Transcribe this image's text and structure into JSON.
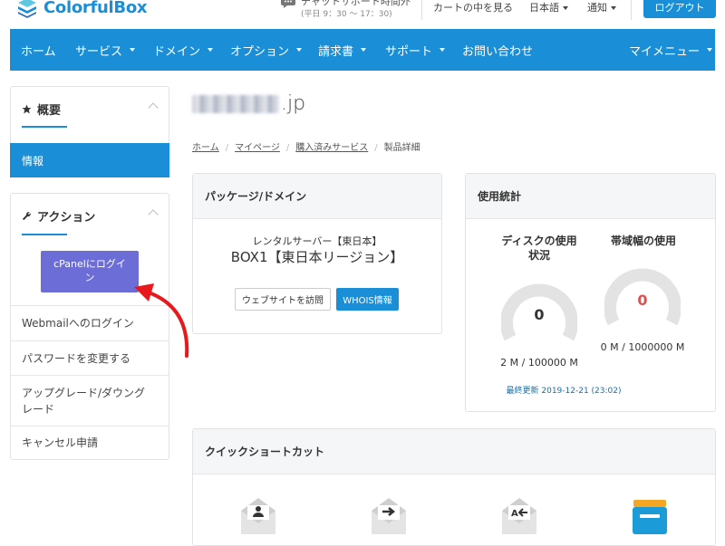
{
  "brand": {
    "name": "ColorfulBox",
    "accent": "#1a8fd8"
  },
  "topbar": {
    "support_title": "チャットサポート時間外",
    "support_hours": "(平日 9：30 ～ 17：30)",
    "cart_link": "カートの中を見る",
    "language": "日本語",
    "notifications": "通知",
    "logout": "ログアウト"
  },
  "nav": {
    "items": [
      "ホーム",
      "サービス",
      "ドメイン",
      "オプション",
      "請求書",
      "サポート",
      "お問い合わせ"
    ],
    "my_menu": "マイメニュー"
  },
  "sidebar": {
    "overview_title": "概要",
    "overview_active": "情報",
    "actions_title": "アクション",
    "cpanel_button": "cPanelにログイン",
    "cpanel_button_l1": "cPanelにログイ",
    "cpanel_button_l2": "ン",
    "links": [
      "Webmailへのログイン",
      "パスワードを変更する",
      "アップグレード/ダウングレード",
      "キャンセル申請"
    ],
    "upgrade_l1": "アップグレード/ダウング",
    "upgrade_l2": "レード"
  },
  "page": {
    "domain_suffix": ".jp",
    "breadcrumb": [
      "ホーム",
      "マイページ",
      "購入済みサービス",
      "製品詳細"
    ]
  },
  "package": {
    "title": "パッケージ/ドメイン",
    "server_type": "レンタルサーバー【東日本】",
    "plan": "BOX1【東日本リージョン】",
    "visit_button": "ウェブサイトを訪問",
    "whois_button": "WHOIS情報"
  },
  "usage": {
    "title": "使用統計",
    "disk_label_l1": "ディスクの使用",
    "disk_label_l2": "状況",
    "disk_value": "0",
    "disk_caption": "2 M / 100000 M",
    "disk_fraction": 0.0,
    "bandwidth_label": "帯域幅の使用",
    "bandwidth_value": "0",
    "bandwidth_caption": "0 M / 1000000 M",
    "bandwidth_fraction": 0.0,
    "last_updated": "最終更新 2019-12-21 (23:02)",
    "disk_color": "#333333",
    "bandwidth_color": "#d9534f"
  },
  "shortcuts": {
    "title": "クイックショートカット",
    "icons": [
      "envelope-user-icon",
      "envelope-forward-icon",
      "envelope-autoresponder-icon",
      "file-manager-icon"
    ]
  }
}
